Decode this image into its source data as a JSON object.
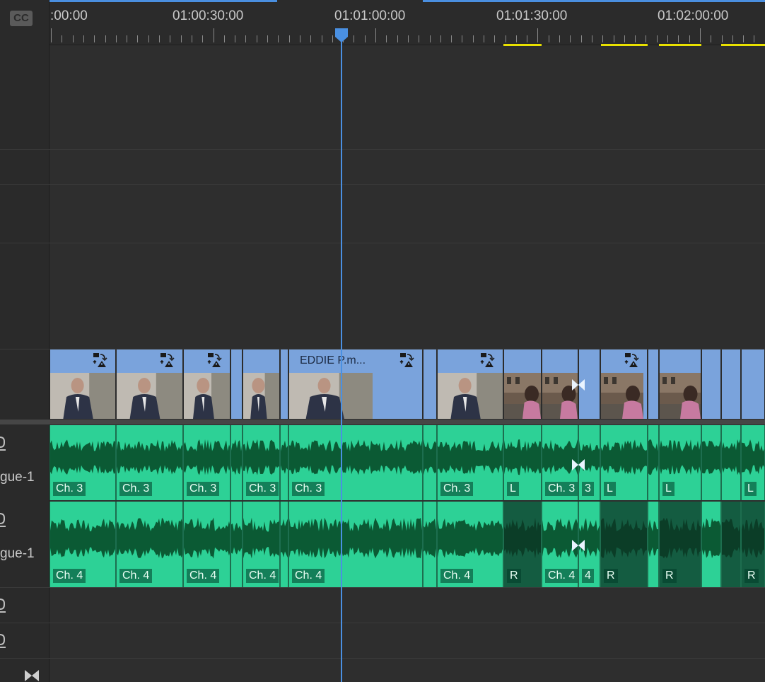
{
  "timeline": {
    "cc_label": "CC",
    "timecodes": [
      ":00:00",
      "01:00:30:00",
      "01:01:00:00",
      "01:01:30:00",
      "01:02:00:00"
    ],
    "tracks": {
      "a1_name": "gue-1",
      "a2_name": "gue-1"
    },
    "video_clips": [
      {
        "name": "",
        "warning": true,
        "thumb": "interview"
      },
      {
        "name": "",
        "warning": true,
        "thumb": "interview"
      },
      {
        "name": "",
        "warning": true,
        "thumb": "interview"
      },
      {
        "name": "",
        "warning": false,
        "thumb": "none"
      },
      {
        "name": "",
        "warning": false,
        "thumb": "interview"
      },
      {
        "name": "",
        "warning": false,
        "thumb": "none"
      },
      {
        "name": "EDDIE P.m...",
        "warning": true,
        "thumb": "interview"
      },
      {
        "name": "",
        "warning": false,
        "thumb": "none"
      },
      {
        "name": "",
        "warning": true,
        "thumb": "interview"
      },
      {
        "name": "",
        "warning": false,
        "thumb": "street"
      },
      {
        "name": "",
        "warning": false,
        "thumb": "street"
      },
      {
        "name": "",
        "warning": false,
        "thumb": "none"
      },
      {
        "name": "",
        "warning": true,
        "thumb": "street"
      },
      {
        "name": "",
        "warning": false,
        "thumb": "none"
      },
      {
        "name": "",
        "warning": false,
        "thumb": "street"
      },
      {
        "name": "",
        "warning": false,
        "thumb": "none"
      },
      {
        "name": "",
        "warning": false,
        "thumb": "none"
      },
      {
        "name": "",
        "warning": false,
        "thumb": "none"
      }
    ],
    "a1_clips": [
      {
        "label": "Ch. 3",
        "dark": false
      },
      {
        "label": "Ch. 3",
        "dark": false
      },
      {
        "label": "Ch. 3",
        "dark": false
      },
      {
        "label": "",
        "dark": false
      },
      {
        "label": "Ch. 3",
        "dark": false
      },
      {
        "label": "",
        "dark": false
      },
      {
        "label": "Ch. 3",
        "dark": false
      },
      {
        "label": "",
        "dark": false
      },
      {
        "label": "Ch. 3",
        "dark": false
      },
      {
        "label": "L",
        "dark": false
      },
      {
        "label": "Ch. 3",
        "dark": false
      },
      {
        "label": "3",
        "dark": false
      },
      {
        "label": "L",
        "dark": false
      },
      {
        "label": "",
        "dark": false
      },
      {
        "label": "L",
        "dark": false
      },
      {
        "label": "",
        "dark": false
      },
      {
        "label": "",
        "dark": false
      },
      {
        "label": "L",
        "dark": false
      }
    ],
    "a2_clips": [
      {
        "label": "Ch. 4",
        "dark": false
      },
      {
        "label": "Ch. 4",
        "dark": false
      },
      {
        "label": "Ch. 4",
        "dark": false
      },
      {
        "label": "",
        "dark": false
      },
      {
        "label": "Ch. 4",
        "dark": false
      },
      {
        "label": "",
        "dark": false
      },
      {
        "label": "Ch. 4",
        "dark": false
      },
      {
        "label": "",
        "dark": false
      },
      {
        "label": "Ch. 4",
        "dark": false
      },
      {
        "label": "R",
        "dark": true
      },
      {
        "label": "Ch. 4",
        "dark": false
      },
      {
        "label": "4",
        "dark": false
      },
      {
        "label": "R",
        "dark": true
      },
      {
        "label": "",
        "dark": false
      },
      {
        "label": "R",
        "dark": true
      },
      {
        "label": "",
        "dark": false
      },
      {
        "label": "",
        "dark": true
      },
      {
        "label": "R",
        "dark": true
      }
    ],
    "colors": {
      "playhead": "#4a90e2",
      "video_clip": "#7aa3dc",
      "audio_clip": "#2dd196",
      "audio_dark": "#145c41",
      "waveform": "#0b5a34",
      "render_bar_yellow": "#e8e000",
      "work_area_blue": "#4a8fe0"
    },
    "icons": [
      "cc-icon",
      "playhead-icon",
      "sync-warning-icon",
      "transition-icon",
      "mic-icon"
    ]
  }
}
